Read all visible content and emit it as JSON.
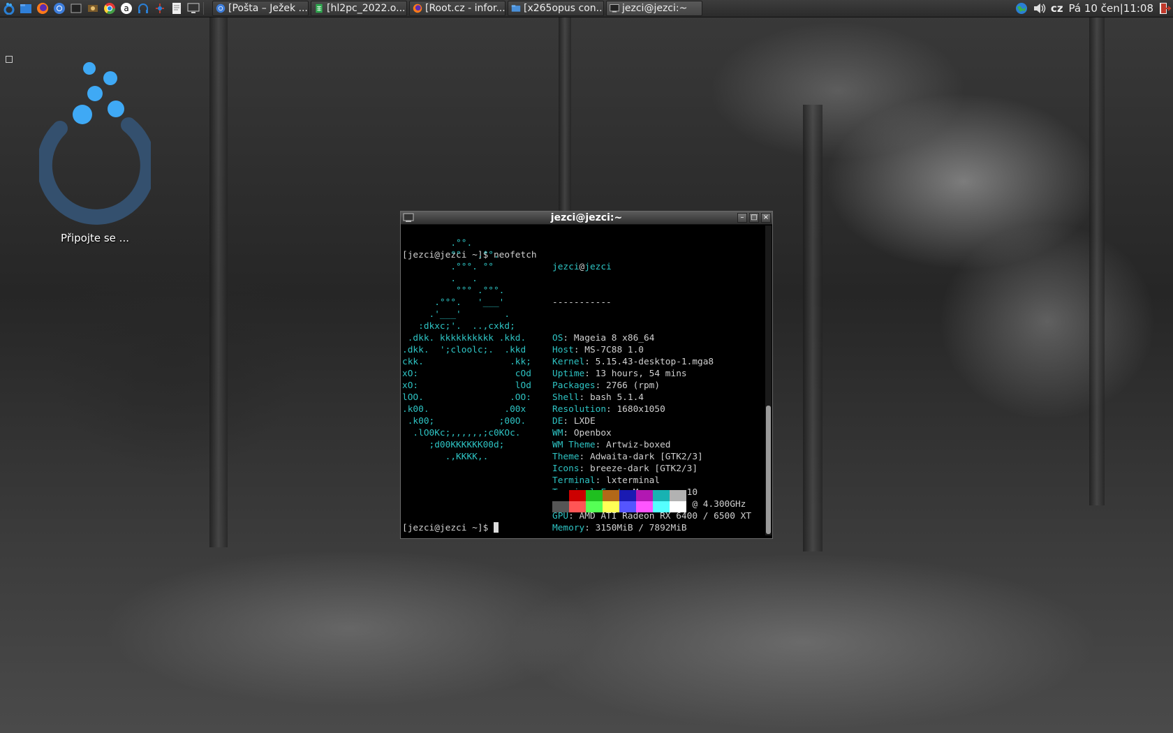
{
  "panel": {
    "launchers": [
      "mageia-menu-icon",
      "files-icon",
      "firefox-icon",
      "chromium-icon",
      "terminal-small-icon",
      "game-icon",
      "chrome-icon",
      "amazon-icon",
      "headphones-icon",
      "network-tool-icon",
      "text-editor-icon",
      "monitor-icon"
    ],
    "tasks": [
      {
        "label": "[Pošta – Ježek ...",
        "icon": "chromium-icon",
        "color": "#4a8fdc"
      },
      {
        "label": "[hl2pc_2022.o...",
        "icon": "spreadsheet-icon",
        "color": "#2fa84f"
      },
      {
        "label": "[Root.cz - infor...",
        "icon": "firefox-icon",
        "color": "#ff7a1a"
      },
      {
        "label": "[x265opus con...",
        "icon": "folder-icon",
        "color": "#4a90d9"
      },
      {
        "label": "jezci@jezci:~",
        "icon": "terminal-icon",
        "color": "#cccccc"
      }
    ],
    "tray": {
      "layout": "cz",
      "clock": "Pá 10 čen|11:08"
    }
  },
  "desktop": {
    "icon_label": "Připojte se ..."
  },
  "terminal": {
    "title": "jezci@jezci:~",
    "command_line": "[jezci@jezci ~]$ neofetch",
    "ascii": [
      "         .°°.",
      "         °°   .°°.",
      "         .°°°. °°",
      "         .   .",
      "          °°° .°°°.",
      "      .°°°.   '___'",
      "     .'___'        .",
      "   :dkxc;'.  ..,cxkd;",
      " .dkk. kkkkkkkkkk .kkd.",
      ".dkk.  ';cloolc;.  .kkd",
      "ckk.                .kk;",
      "xO:                  cOd",
      "xO:                  lOd",
      "lOO.                .OO:",
      ".k00.              .00x",
      " .k00;            ;00O.",
      "  .lO0Kc;,,,,,,;c0KOc.",
      "     ;d00KKKKKK00d;",
      "        .,KKKK,."
    ],
    "user": "jezci",
    "at": "@",
    "host": "jezci",
    "separator": "-----------",
    "info": [
      {
        "key": "OS",
        "value": ": Mageia 8 x86_64"
      },
      {
        "key": "Host",
        "value": ": MS-7C88 1.0"
      },
      {
        "key": "Kernel",
        "value": ": 5.15.43-desktop-1.mga8"
      },
      {
        "key": "Uptime",
        "value": ": 13 hours, 54 mins"
      },
      {
        "key": "Packages",
        "value": ": 2766 (rpm)"
      },
      {
        "key": "Shell",
        "value": ": bash 5.1.4"
      },
      {
        "key": "Resolution",
        "value": ": 1680x1050"
      },
      {
        "key": "DE",
        "value": ": LXDE"
      },
      {
        "key": "WM",
        "value": ": Openbox"
      },
      {
        "key": "WM Theme",
        "value": ": Artwiz-boxed"
      },
      {
        "key": "Theme",
        "value": ": Adwaita-dark [GTK2/3]"
      },
      {
        "key": "Icons",
        "value": ": breeze-dark [GTK2/3]"
      },
      {
        "key": "Terminal",
        "value": ": lxterminal"
      },
      {
        "key": "Terminal Font",
        "value": ": Monospace 10"
      },
      {
        "key": "CPU",
        "value": ": Intel i5-10400F (12) @ 4.300GHz"
      },
      {
        "key": "GPU",
        "value": ": AMD ATI Radeon RX 6400 / 6500 XT"
      },
      {
        "key": "Memory",
        "value": ": 3150MiB / 7892MiB"
      }
    ],
    "palette_top": [
      "#000000",
      "#cc0000",
      "#1fbf1f",
      "#b26818",
      "#1a1ab2",
      "#b218b2",
      "#18b2b2",
      "#b2b2b2"
    ],
    "palette_bottom": [
      "#555555",
      "#ff5555",
      "#55ff55",
      "#ffff55",
      "#5555ff",
      "#ff55ff",
      "#55ffff",
      "#ffffff"
    ],
    "prompt": "[jezci@jezci ~]$ "
  }
}
